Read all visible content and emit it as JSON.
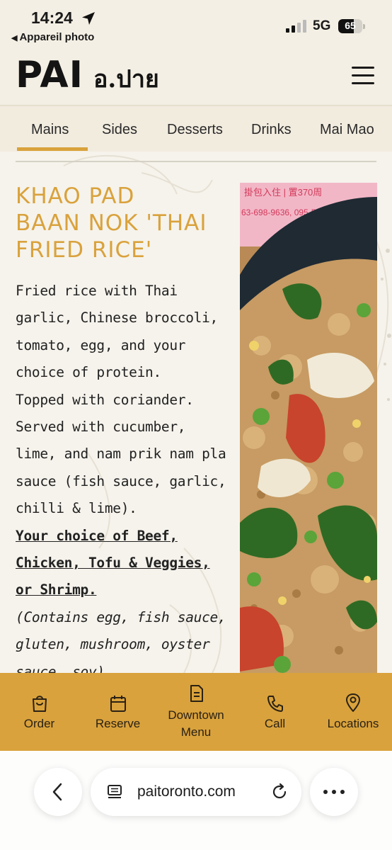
{
  "status_bar": {
    "time": "14:24",
    "back_app": "Appareil photo",
    "network": "5G",
    "battery_level": "65"
  },
  "header": {
    "logo_primary": "PAI",
    "logo_thai": "อ.ปาย"
  },
  "tabs": [
    "Mains",
    "Sides",
    "Desserts",
    "Drinks",
    "Mai Mao"
  ],
  "active_tab": "Mains",
  "dish": {
    "title_lines": [
      "KHAO PAD",
      "BAAN NOK 'THAI",
      "FRIED RICE'"
    ],
    "description_lines": [
      "Fried rice with Thai",
      "garlic, Chinese broccoli,",
      "tomato, egg, and your",
      "choice of protein.",
      "Topped with coriander.",
      "Served with cucumber,",
      "lime, and nam prik nam pla",
      "sauce (fish sauce, garlic,",
      "chilli & lime)."
    ],
    "choice_lines": [
      "Your choice of Beef,",
      "Chicken, Tofu & Veggies,",
      "or Shrimp."
    ],
    "allergen_lines": [
      "(Contains egg, fish sauce,",
      "gluten, mushroom, oyster",
      "sauce, soy)"
    ],
    "photo_alt": "fried-rice-photo"
  },
  "actions": [
    {
      "label": "Order",
      "icon": "shopping-bag-icon"
    },
    {
      "label": "Reserve",
      "icon": "calendar-icon"
    },
    {
      "label": "Downtown Menu",
      "icon": "document-icon"
    },
    {
      "label": "Call",
      "icon": "phone-icon"
    },
    {
      "label": "Locations",
      "icon": "map-pin-icon"
    }
  ],
  "browser": {
    "url": "paitoronto.com"
  },
  "colors": {
    "accent": "#d9a23c",
    "background": "#f4efe4"
  }
}
